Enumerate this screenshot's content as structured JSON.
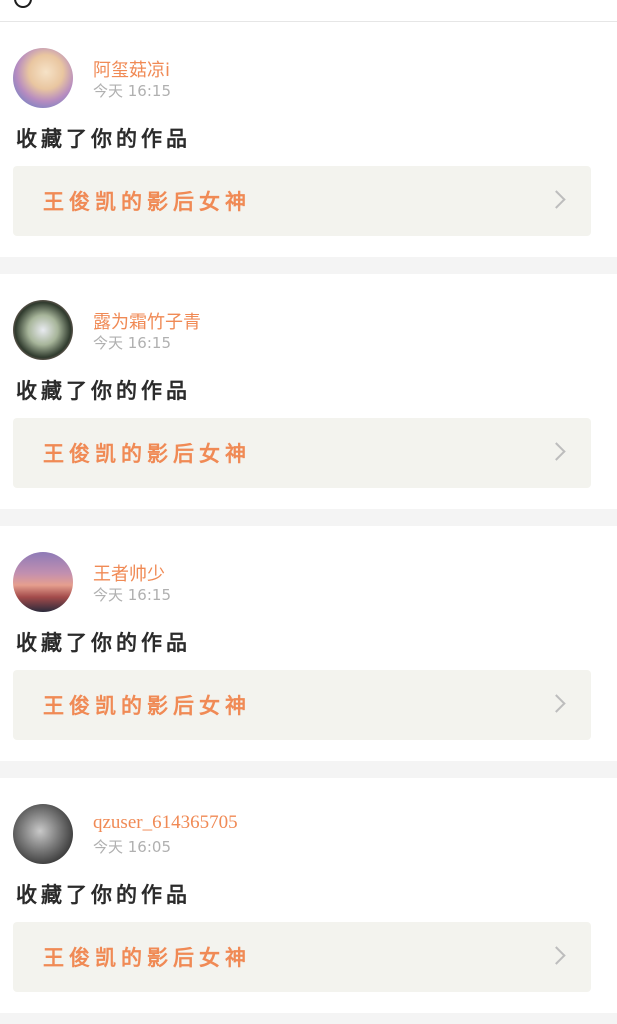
{
  "notifications": [
    {
      "username": "阿玺菇凉i",
      "time": "今天 16:15",
      "action": "收藏了你的作品",
      "work_title": "王俊凯的影后女神"
    },
    {
      "username": "露为霜竹子青",
      "time": "今天 16:15",
      "action": "收藏了你的作品",
      "work_title": "王俊凯的影后女神"
    },
    {
      "username": "王者帅少",
      "time": "今天 16:15",
      "action": "收藏了你的作品",
      "work_title": "王俊凯的影后女神"
    },
    {
      "username": "qzuser_614365705",
      "time": "今天 16:05",
      "action": "收藏了你的作品",
      "work_title": "王俊凯的影后女神"
    }
  ],
  "colors": {
    "accent": "#f08a55",
    "timestamp": "#b0b0b0",
    "work_box_bg": "#f3f3ee",
    "page_bg": "#f4f4f4"
  }
}
